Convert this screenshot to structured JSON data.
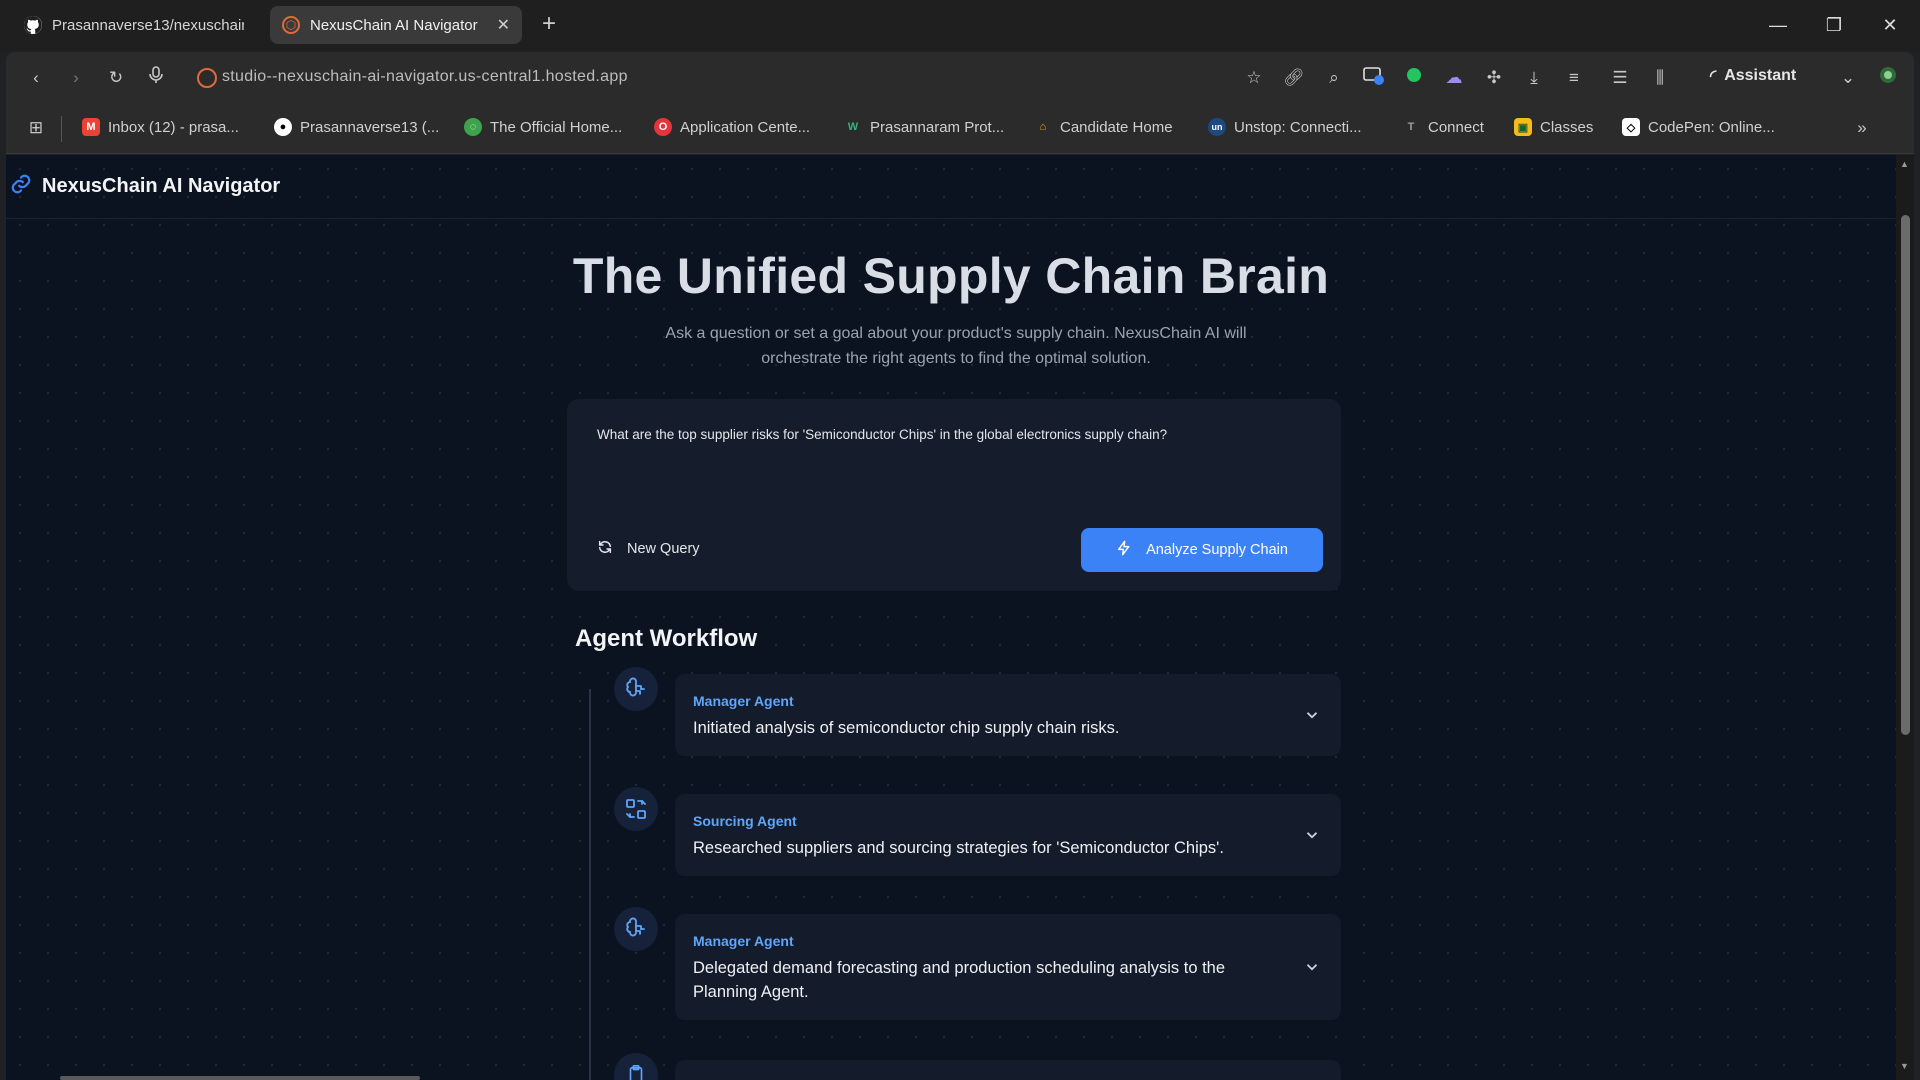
{
  "browser": {
    "tabs": [
      {
        "title": "Prasannaverse13/nexuschain",
        "active": false
      },
      {
        "title": "NexusChain AI Navigator",
        "active": true
      }
    ],
    "url": "studio--nexuschain-ai-navigator.us-central1.hosted.app",
    "assistant_label": "Assistant",
    "bookmarks": [
      {
        "label": "Inbox (12) - prasa...",
        "icon": "gmail-icon",
        "color": "#ea4335"
      },
      {
        "label": "Prasannaverse13 (...",
        "icon": "github-icon",
        "color": "#ffffff"
      },
      {
        "label": "The Official Home...",
        "icon": "globe-icon",
        "color": "#3fa34d"
      },
      {
        "label": "Application Cente...",
        "icon": "opera-icon",
        "color": "#e5343b"
      },
      {
        "label": "Prasannaram Prot...",
        "icon": "webflow-icon",
        "color": "#36b37e"
      },
      {
        "label": "Candidate Home",
        "icon": "candidate-icon",
        "color": "#f4b400"
      },
      {
        "label": "Unstop: Connecti...",
        "icon": "unstop-icon",
        "color": "#1c4980"
      },
      {
        "label": "Connect",
        "icon": "connect-icon",
        "color": "#9e9e9e"
      },
      {
        "label": "Classes",
        "icon": "classroom-icon",
        "color": "#f6bb18"
      },
      {
        "label": "CodePen: Online...",
        "icon": "codepen-icon",
        "color": "#ffffff"
      }
    ]
  },
  "app": {
    "brand": "NexusChain AI Navigator",
    "hero_title": "The Unified Supply Chain Brain",
    "hero_subtitle": "Ask a question or set a goal about your product's supply chain. NexusChain AI will orchestrate the right agents to find the optimal solution.",
    "query": "What are the top supplier risks for 'Semiconductor Chips' in the global electronics supply chain?",
    "new_query_label": "New Query",
    "analyze_label": "Analyze Supply Chain",
    "workflow_title": "Agent Workflow",
    "steps": [
      {
        "agent": "Manager Agent",
        "description": "Initiated analysis of semiconductor chip supply chain risks."
      },
      {
        "agent": "Sourcing Agent",
        "description": "Researched suppliers and sourcing strategies for 'Semiconductor Chips'."
      },
      {
        "agent": "Manager Agent",
        "description": "Delegated demand forecasting and production scheduling analysis to the Planning Agent."
      }
    ]
  },
  "colors": {
    "accent": "#3b82f6",
    "agent_label": "#60a5fa",
    "page_bg": "#0b1220",
    "card_bg": "#141c2b"
  }
}
